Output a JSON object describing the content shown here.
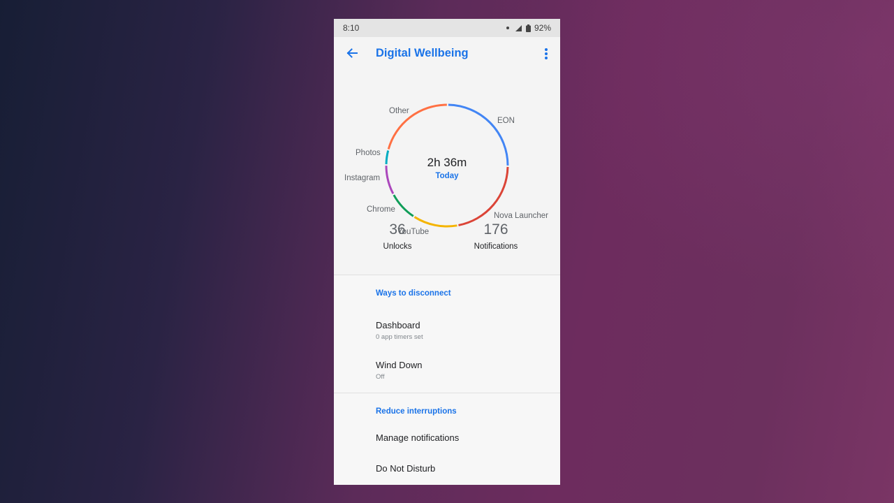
{
  "status_bar": {
    "time": "8:10",
    "battery": "92%"
  },
  "app_bar": {
    "title": "Digital Wellbeing"
  },
  "usage": {
    "total_time": "2h 36m",
    "period": "Today",
    "segments": [
      {
        "label": "EON",
        "fraction": 0.25,
        "color": "#4285f4"
      },
      {
        "label": "Nova Launcher",
        "fraction": 0.22,
        "color": "#db4437"
      },
      {
        "label": "YouTube",
        "fraction": 0.12,
        "color": "#f4b400"
      },
      {
        "label": "Chrome",
        "fraction": 0.08,
        "color": "#0f9d58"
      },
      {
        "label": "Instagram",
        "fraction": 0.08,
        "color": "#ab47bc"
      },
      {
        "label": "Photos",
        "fraction": 0.04,
        "color": "#00acc1"
      },
      {
        "label": "Other",
        "fraction": 0.21,
        "color": "#ff7043"
      }
    ]
  },
  "stats": {
    "unlocks_count": "36",
    "unlocks_label": "Unlocks",
    "notifications_count": "176",
    "notifications_label": "Notifications"
  },
  "sections": {
    "disconnect": {
      "header": "Ways to disconnect",
      "dashboard_title": "Dashboard",
      "dashboard_sub": "0 app timers set",
      "wind_down_title": "Wind Down",
      "wind_down_sub": "Off"
    },
    "interruptions": {
      "header": "Reduce interruptions",
      "manage_notifications": "Manage notifications",
      "do_not_disturb": "Do Not Disturb"
    }
  },
  "colors": {
    "accent": "#1a73e8"
  }
}
